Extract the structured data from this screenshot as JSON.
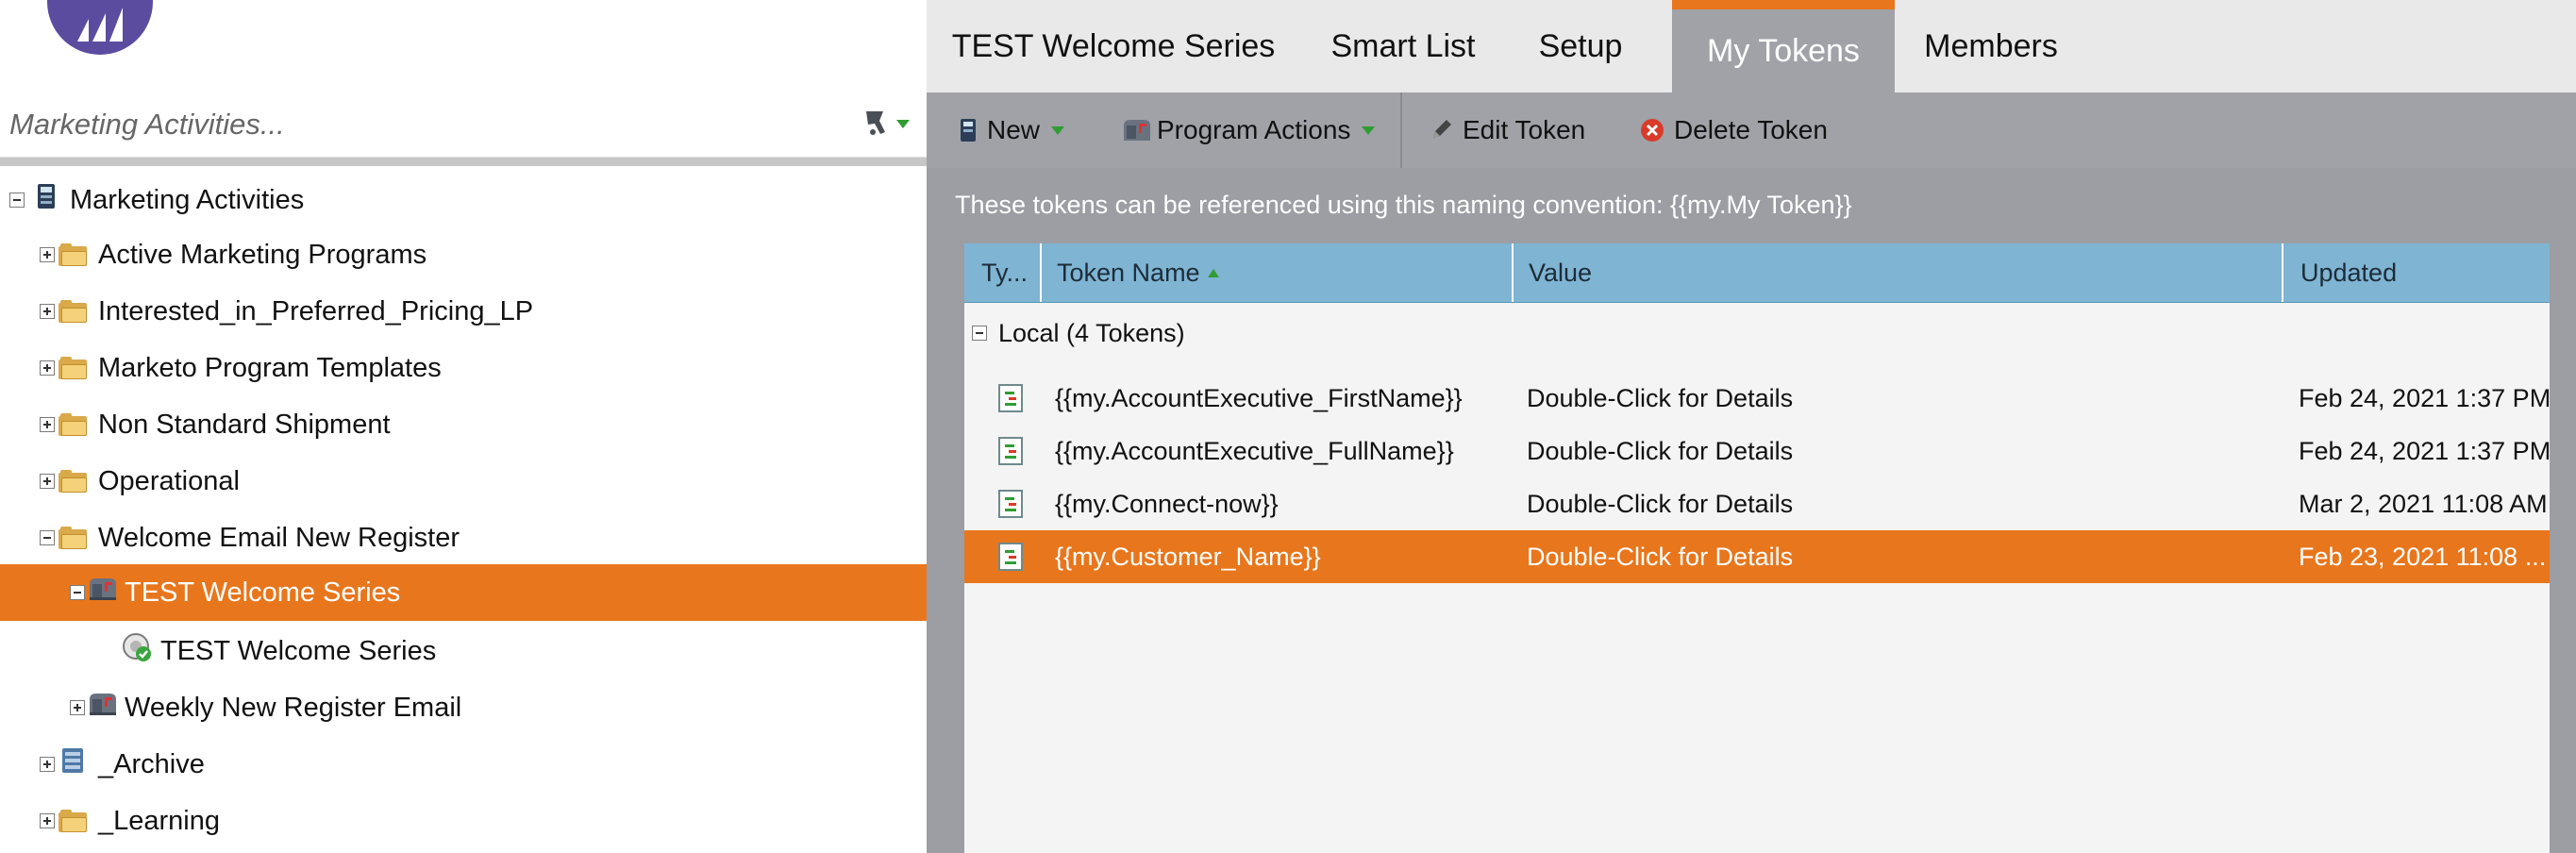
{
  "sidebar": {
    "search_placeholder": "Marketing Activities...",
    "tree": [
      {
        "label": "Marketing Activities",
        "level": 0,
        "expanded": true
      },
      {
        "label": "Active Marketing Programs",
        "level": 1,
        "expanded": false
      },
      {
        "label": "Interested_in_Preferred_Pricing_LP",
        "level": 1,
        "expanded": false
      },
      {
        "label": "Marketo Program Templates",
        "level": 1,
        "expanded": false
      },
      {
        "label": "Non Standard Shipment",
        "level": 1,
        "expanded": false
      },
      {
        "label": "Operational",
        "level": 1,
        "expanded": false
      },
      {
        "label": "Welcome Email New Register",
        "level": 1,
        "expanded": true
      },
      {
        "label": "TEST Welcome Series",
        "level": 2,
        "expanded": true,
        "selected": true
      },
      {
        "label": "TEST Welcome Series",
        "level": 3
      },
      {
        "label": "Weekly New Register Email",
        "level": 2,
        "expanded": false
      },
      {
        "label": "_Archive",
        "level": 1,
        "expanded": false
      },
      {
        "label": "_Learning",
        "level": 1,
        "expanded": false
      }
    ]
  },
  "tabs": [
    {
      "label": "TEST Welcome Series"
    },
    {
      "label": "Smart List"
    },
    {
      "label": "Setup"
    },
    {
      "label": "My Tokens",
      "active": true
    },
    {
      "label": "Members"
    }
  ],
  "toolbar": {
    "new_label": "New",
    "program_actions_label": "Program Actions",
    "edit_token_label": "Edit Token",
    "delete_token_label": "Delete Token"
  },
  "tokens": {
    "hint": "These tokens can be referenced using this naming convention: {{my.My Token}}",
    "columns": {
      "type": "Ty...",
      "name": "Token Name",
      "value": "Value",
      "updated": "Updated"
    },
    "group_label": "Local (4 Tokens)",
    "rows": [
      {
        "name": "{{my.AccountExecutive_FirstName}}",
        "value": "Double-Click for Details",
        "updated": "Feb 24, 2021 1:37 PM"
      },
      {
        "name": "{{my.AccountExecutive_FullName}}",
        "value": "Double-Click for Details",
        "updated": "Feb 24, 2021 1:37 PM"
      },
      {
        "name": "{{my.Connect-now}}",
        "value": "Double-Click for Details",
        "updated": "Mar 2, 2021 11:08 AM"
      },
      {
        "name": "{{my.Customer_Name}}",
        "value": "Double-Click for Details",
        "updated": "Feb 23, 2021 11:08 ...",
        "selected": true
      }
    ]
  },
  "colors": {
    "accent": "#e8761c",
    "header_blue": "#7fb4d3",
    "panel_gray": "#9c9ea4",
    "logo_purple": "#5c4c9f"
  }
}
